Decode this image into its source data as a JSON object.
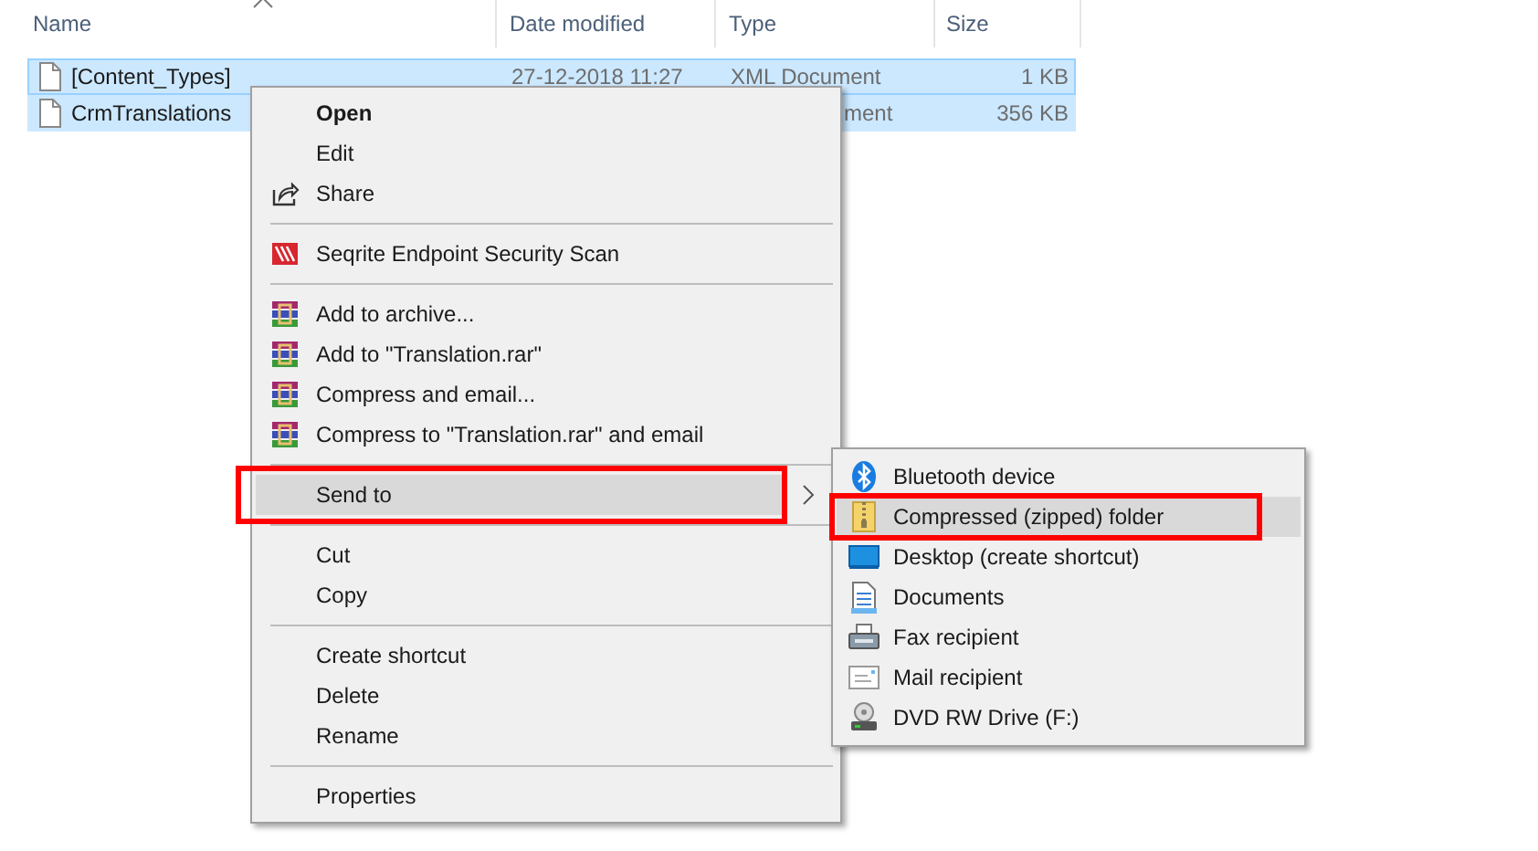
{
  "columns": [
    {
      "label": "Name",
      "sorted": true
    },
    {
      "label": "Date modified",
      "sorted": false
    },
    {
      "label": "Type",
      "sorted": false
    },
    {
      "label": "Size",
      "sorted": false
    }
  ],
  "files": [
    {
      "name": "[Content_Types]",
      "date": "27-12-2018 11:27",
      "type": "XML Document",
      "type_partial": false,
      "size": "1 KB",
      "selected": true,
      "focused": true
    },
    {
      "name": "CrmTranslations",
      "type": "ment",
      "type_partial": true,
      "size": "356 KB",
      "selected": true,
      "focused": false
    }
  ],
  "context_menu": {
    "items": [
      {
        "kind": "item",
        "label": "Open",
        "bold": true,
        "selected": false,
        "annotated": false
      },
      {
        "kind": "item",
        "label": "Edit",
        "bold": false,
        "selected": false,
        "annotated": false
      },
      {
        "kind": "item",
        "label": "Share",
        "bold": false,
        "selected": false,
        "annotated": false
      },
      {
        "kind": "separator"
      },
      {
        "kind": "item",
        "label": "Seqrite Endpoint Security Scan",
        "bold": false,
        "selected": false,
        "annotated": false
      },
      {
        "kind": "separator"
      },
      {
        "kind": "item",
        "label": "Add to archive...",
        "bold": false,
        "selected": false,
        "annotated": false
      },
      {
        "kind": "item",
        "label": "Add to \"Translation.rar\"",
        "bold": false,
        "selected": false,
        "annotated": false
      },
      {
        "kind": "item",
        "label": "Compress and email...",
        "bold": false,
        "selected": false,
        "annotated": false
      },
      {
        "kind": "item",
        "label": "Compress to \"Translation.rar\" and email",
        "bold": false,
        "selected": false,
        "annotated": false
      },
      {
        "kind": "separator"
      },
      {
        "kind": "submenu",
        "label": "Send to",
        "bold": false,
        "selected": true,
        "annotated": true
      },
      {
        "kind": "separator"
      },
      {
        "kind": "item",
        "label": "Cut",
        "bold": false,
        "selected": false,
        "annotated": false
      },
      {
        "kind": "item",
        "label": "Copy",
        "bold": false,
        "selected": false,
        "annotated": false
      },
      {
        "kind": "separator"
      },
      {
        "kind": "item",
        "label": "Create shortcut",
        "bold": false,
        "selected": false,
        "annotated": false
      },
      {
        "kind": "item",
        "label": "Delete",
        "bold": false,
        "selected": false,
        "annotated": false
      },
      {
        "kind": "item",
        "label": "Rename",
        "bold": false,
        "selected": false,
        "annotated": false
      },
      {
        "kind": "separator"
      },
      {
        "kind": "item",
        "label": "Properties",
        "bold": false,
        "selected": false,
        "annotated": false
      }
    ]
  },
  "send_to_menu": {
    "items": [
      {
        "label": "Bluetooth device",
        "selected": false,
        "annotated": false
      },
      {
        "label": "Compressed (zipped) folder",
        "selected": true,
        "annotated": true
      },
      {
        "label": "Desktop (create shortcut)",
        "selected": false,
        "annotated": false
      },
      {
        "label": "Documents",
        "selected": false,
        "annotated": false
      },
      {
        "label": "Fax recipient",
        "selected": false,
        "annotated": false
      },
      {
        "label": "Mail recipient",
        "selected": false,
        "annotated": false
      },
      {
        "label": "DVD RW Drive (F:)",
        "selected": false,
        "annotated": false
      }
    ]
  }
}
